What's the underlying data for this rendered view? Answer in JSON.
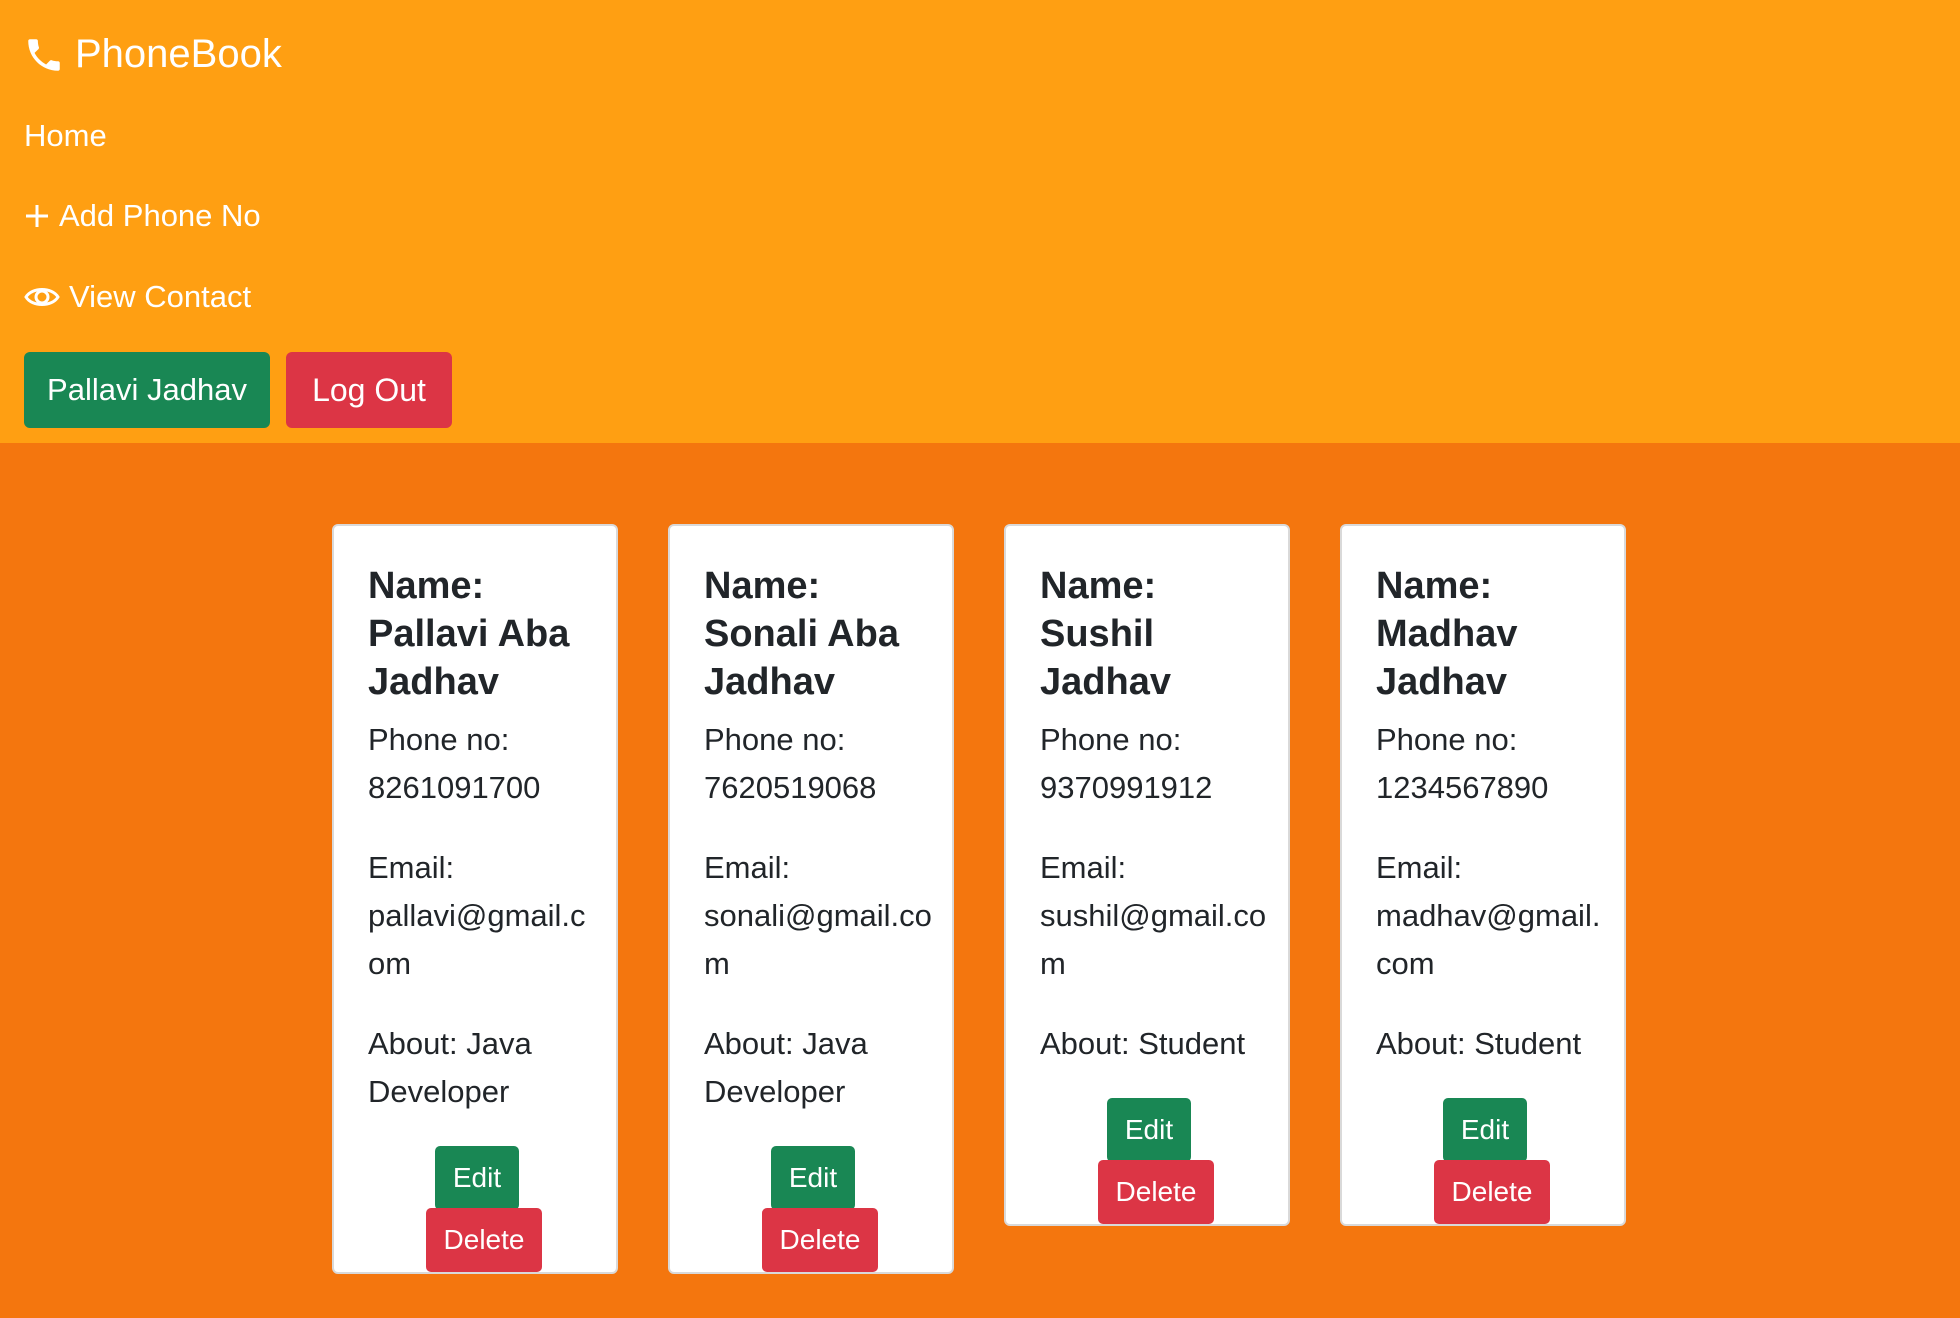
{
  "colors": {
    "navbar_bg": "#ff9f12",
    "page_bg": "#f4760e",
    "success": "#198754",
    "danger": "#dc3545",
    "card_bg": "#ffffff"
  },
  "navbar": {
    "brand": "PhoneBook",
    "brand_icon": "phone-icon",
    "links": {
      "home": "Home",
      "add": "Add Phone No",
      "add_icon": "plus-icon",
      "view": "View Contact",
      "view_icon": "eye-icon"
    },
    "user_button": "Pallavi Jadhav",
    "logout_button": "Log Out"
  },
  "contacts": [
    {
      "name": "Name: Pallavi Aba Jadhav",
      "phone": "Phone no: 8261091700",
      "email": "Email: pallavi@gmail.com",
      "about": "About: Java Developer",
      "edit": "Edit",
      "delete": "Delete"
    },
    {
      "name": "Name: Sonali Aba Jadhav",
      "phone": "Phone no: 7620519068",
      "email": "Email: sonali@gmail.com",
      "about": "About: Java Developer",
      "edit": "Edit",
      "delete": "Delete"
    },
    {
      "name": "Name: Sushil Jadhav",
      "phone": "Phone no: 9370991912",
      "email": "Email: sushil@gmail.com",
      "about": "About: Student",
      "edit": "Edit",
      "delete": "Delete"
    },
    {
      "name": "Name: Madhav Jadhav",
      "phone": "Phone no: 1234567890",
      "email": "Email: madhav@gmail.com",
      "about": "About: Student",
      "edit": "Edit",
      "delete": "Delete"
    }
  ]
}
